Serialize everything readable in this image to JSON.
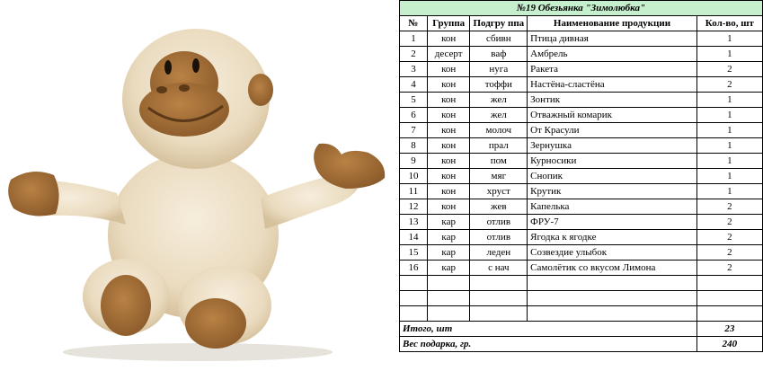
{
  "sheet": {
    "title": "№19 Обезьянка \"Зимолюбка\"",
    "headers": {
      "num": "№",
      "group": "Группа",
      "sub": "Подгру ппа",
      "name": "Наименование продукции",
      "qty": "Кол-во, шт"
    },
    "rows": [
      {
        "num": "1",
        "group": "кон",
        "sub": "сбивн",
        "name": "Птица дивная",
        "qty": "1"
      },
      {
        "num": "2",
        "group": "десерт",
        "sub": "ваф",
        "name": "Амбрель",
        "qty": "1"
      },
      {
        "num": "3",
        "group": "кон",
        "sub": "нуга",
        "name": "Ракета",
        "qty": "2"
      },
      {
        "num": "4",
        "group": "кон",
        "sub": "тоффи",
        "name": "Настёна-сластёна",
        "qty": "2"
      },
      {
        "num": "5",
        "group": "кон",
        "sub": "жел",
        "name": "Зонтик",
        "qty": "1"
      },
      {
        "num": "6",
        "group": "кон",
        "sub": "жел",
        "name": "Отважный комарик",
        "qty": "1"
      },
      {
        "num": "7",
        "group": "кон",
        "sub": "молоч",
        "name": "От Красули",
        "qty": "1"
      },
      {
        "num": "8",
        "group": "кон",
        "sub": "прал",
        "name": "Зернушка",
        "qty": "1"
      },
      {
        "num": "9",
        "group": "кон",
        "sub": "пом",
        "name": "Курносики",
        "qty": "1"
      },
      {
        "num": "10",
        "group": "кон",
        "sub": "мяг",
        "name": "Снопик",
        "qty": "1"
      },
      {
        "num": "11",
        "group": "кон",
        "sub": "хруст",
        "name": "Крутик",
        "qty": "1"
      },
      {
        "num": "12",
        "group": "кон",
        "sub": "жев",
        "name": "Капелька",
        "qty": "2"
      },
      {
        "num": "13",
        "group": "кар",
        "sub": "отлив",
        "name": "ФРУ-7",
        "qty": "2"
      },
      {
        "num": "14",
        "group": "кар",
        "sub": "отлив",
        "name": "Ягодка к ягодке",
        "qty": "2"
      },
      {
        "num": "15",
        "group": "кар",
        "sub": "леден",
        "name": "Созвездие улыбок",
        "qty": "2"
      },
      {
        "num": "16",
        "group": "кар",
        "sub": "с нач",
        "name": "Самолётик со вкусом Лимона",
        "qty": "2"
      }
    ],
    "total_label": "Итого, шт",
    "total_value": "23",
    "weight_label": "Вес подарка, гр.",
    "weight_value": "240"
  },
  "colors": {
    "title_bg": "#c6efce",
    "fur": "#efe3cd",
    "fur_shadow": "#d9c6a4",
    "brown": "#a66f36",
    "brown_dark": "#7d4f22"
  }
}
